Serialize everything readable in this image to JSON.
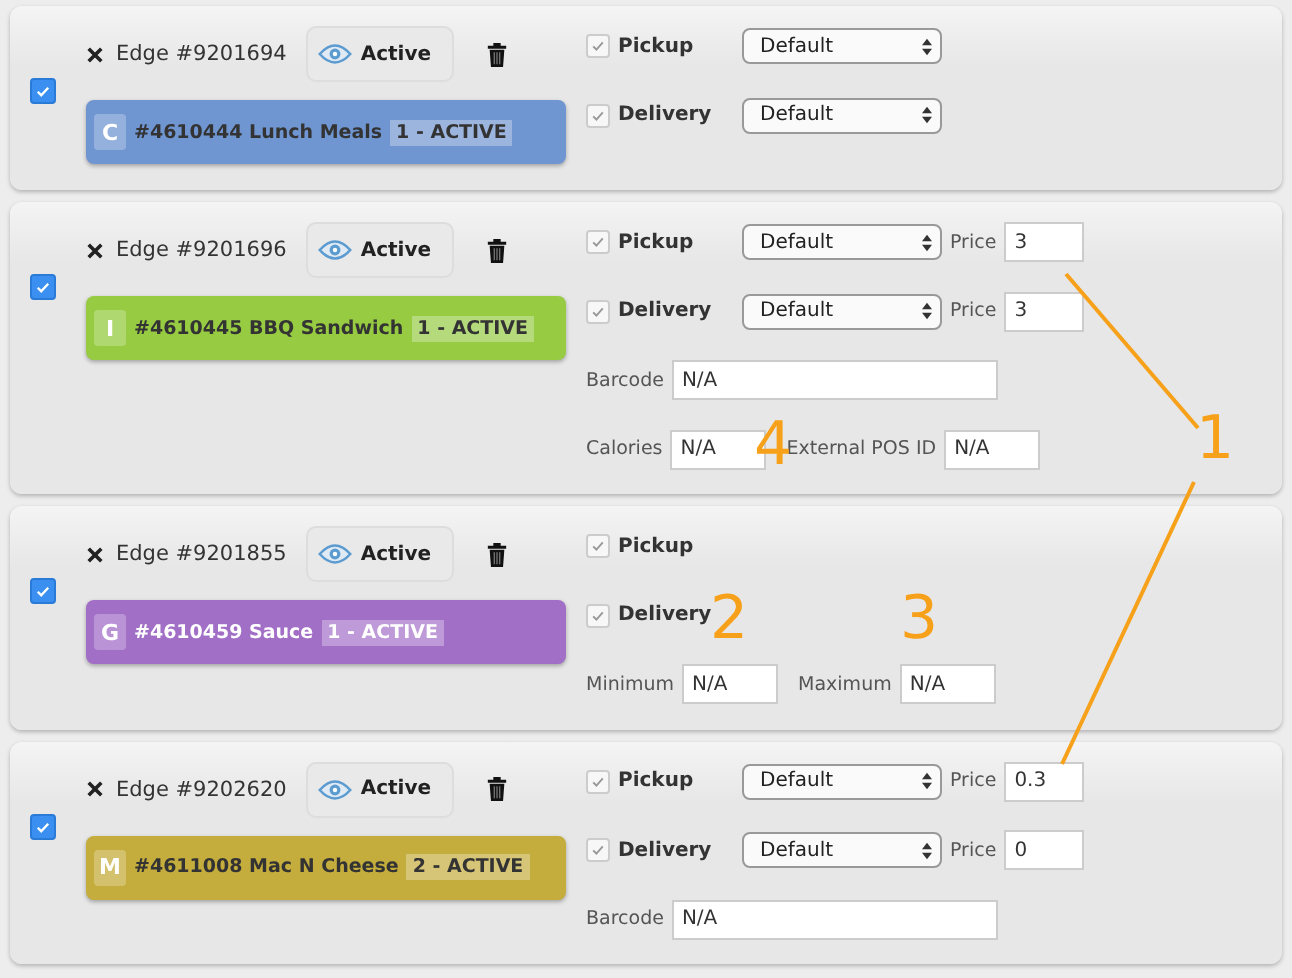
{
  "items": [
    {
      "selected": true,
      "edge": "Edge #9201694",
      "status": "Active",
      "product": {
        "letter": "C",
        "name": "#4610444 Lunch Meals",
        "badge": "1 - ACTIVE",
        "color": "#7096d2"
      },
      "channels": [
        {
          "label": "Pickup",
          "checked": true,
          "select": "Default"
        },
        {
          "label": "Delivery",
          "checked": true,
          "select": "Default"
        }
      ]
    },
    {
      "selected": true,
      "edge": "Edge #9201696",
      "status": "Active",
      "product": {
        "letter": "I",
        "name": "#4610445 BBQ Sandwich",
        "badge": "1 - ACTIVE",
        "color": "#96cb42"
      },
      "channels": [
        {
          "label": "Pickup",
          "checked": true,
          "select": "Default",
          "price_label": "Price",
          "price": "3"
        },
        {
          "label": "Delivery",
          "checked": true,
          "select": "Default",
          "price_label": "Price",
          "price": "3"
        }
      ],
      "fields": [
        [
          {
            "label": "Barcode",
            "value": "N/A"
          }
        ],
        [
          {
            "label": "Calories",
            "value": "N/A"
          },
          {
            "label": "External POS ID",
            "value": "N/A"
          }
        ]
      ]
    },
    {
      "selected": true,
      "edge": "Edge #9201855",
      "status": "Active",
      "product": {
        "letter": "G",
        "name": "#4610459 Sauce",
        "badge": "1 - ACTIVE",
        "color": "#a26fc7"
      },
      "channels": [
        {
          "label": "Pickup",
          "checked": true
        },
        {
          "label": "Delivery",
          "checked": true
        }
      ],
      "fields": [
        [
          {
            "label": "Minimum",
            "value": "N/A"
          },
          {
            "label": "Maximum",
            "value": "N/A"
          }
        ]
      ]
    },
    {
      "selected": true,
      "edge": "Edge #9202620",
      "status": "Active",
      "product": {
        "letter": "M",
        "name": "#4611008 Mac N Cheese",
        "badge": "2 - ACTIVE",
        "color": "#c4ad3c"
      },
      "channels": [
        {
          "label": "Pickup",
          "checked": true,
          "select": "Default",
          "price_label": "Price",
          "price": "0.3"
        },
        {
          "label": "Delivery",
          "checked": true,
          "select": "Default",
          "price_label": "Price",
          "price": "0"
        }
      ],
      "fields": [
        [
          {
            "label": "Barcode",
            "value": "N/A"
          }
        ]
      ]
    }
  ],
  "annotations": [
    {
      "text": "1"
    },
    {
      "text": "2"
    },
    {
      "text": "3"
    },
    {
      "text": "4"
    }
  ]
}
